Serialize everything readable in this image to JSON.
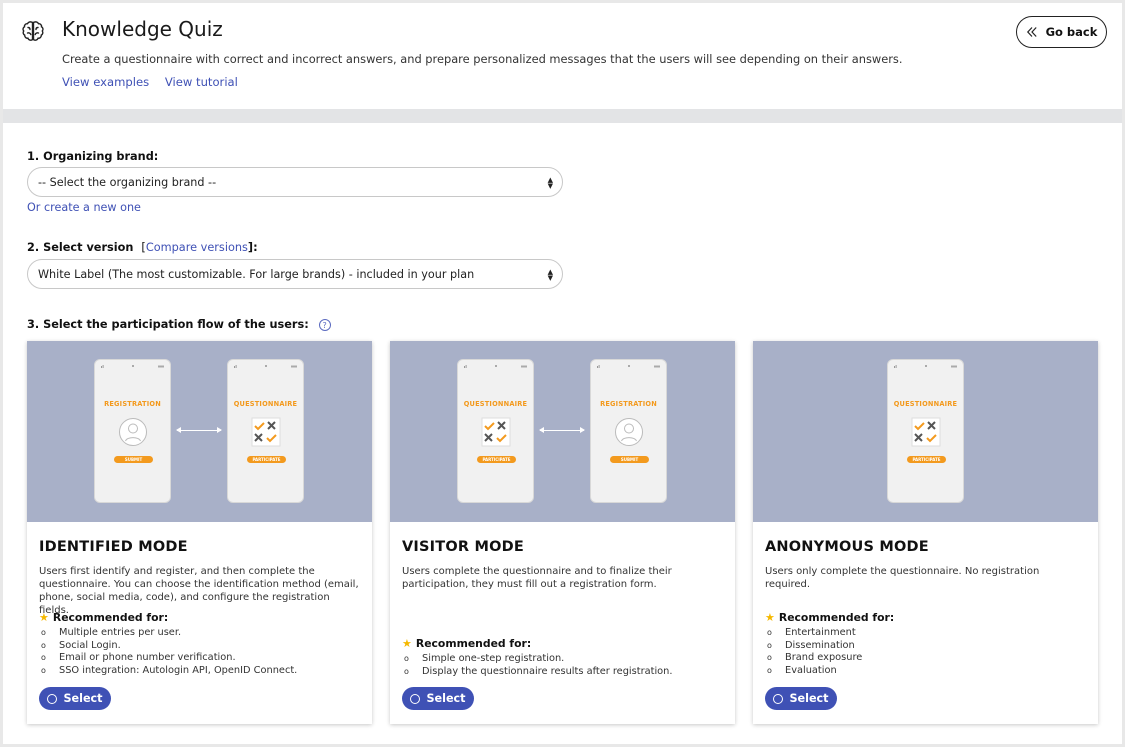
{
  "header": {
    "title": "Knowledge Quiz",
    "description": "Create a questionnaire with correct and incorrect answers, and prepare personalized messages that the users will see depending on their answers.",
    "link_examples": "View examples",
    "link_tutorial": "View tutorial",
    "go_back": "Go back"
  },
  "step1": {
    "label": "1. Organizing brand:",
    "select_value": "-- Select the organizing brand --",
    "create_link": "Or create a new one"
  },
  "step2": {
    "label": "2. Select version",
    "compare_open": "[",
    "compare_link": "Compare versions",
    "compare_close": "]:",
    "select_value": "White Label (The most customizable. For large brands) - included in your plan"
  },
  "step3": {
    "label": "3. Select the participation flow of the users:",
    "help": "?"
  },
  "illustration_labels": {
    "registration": "REGISTRATION",
    "questionnaire": "QUESTIONNAIRE",
    "submit": "SUBMIT",
    "participate": "PARTICIPATE"
  },
  "cards": [
    {
      "title": "IDENTIFIED MODE",
      "description": "Users first identify and register, and then complete the questionnaire. You can choose the identification method (email, phone, social media, code), and configure the registration fields.",
      "recommended_label": "Recommended for:",
      "items": [
        "Multiple entries per user.",
        "Social Login.",
        "Email or phone number verification.",
        "SSO integration: Autologin API, OpenID Connect."
      ],
      "button": "Select"
    },
    {
      "title": "VISITOR MODE",
      "description": "Users complete the questionnaire and to finalize their participation, they must fill out a registration form.",
      "recommended_label": "Recommended for:",
      "items": [
        "Simple one-step registration.",
        "Display the questionnaire results after registration."
      ],
      "button": "Select"
    },
    {
      "title": "ANONYMOUS MODE",
      "description": "Users only complete the questionnaire. No registration required.",
      "recommended_label": "Recommended for:",
      "items": [
        "Entertainment",
        "Dissemination",
        "Brand exposure",
        "Evaluation"
      ],
      "button": "Select"
    }
  ],
  "colors": {
    "accent": "#3f51b5",
    "illustration_bg": "#a8b0c8",
    "illustration_orange": "#f39a1e",
    "star": "#f5b800"
  }
}
